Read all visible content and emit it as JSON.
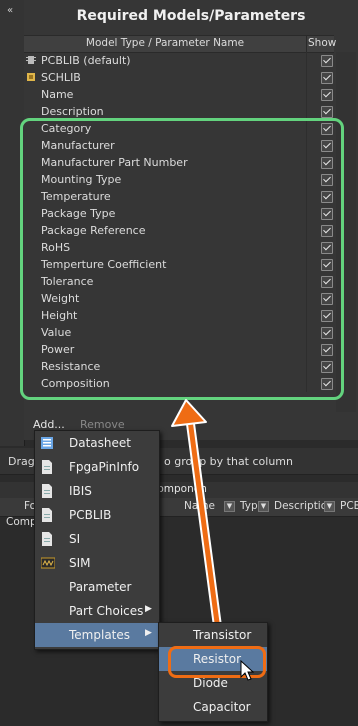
{
  "panel": {
    "collapse_glyph": "«",
    "title": "Required Models/Parameters",
    "col_name": "Model Type / Parameter Name",
    "col_show": "Show",
    "rows": [
      {
        "label": "PCBLIB (default)",
        "icon": "chip-icon"
      },
      {
        "label": "SCHLIB",
        "icon": "schlib-icon"
      },
      {
        "label": "Name"
      },
      {
        "label": "Description"
      },
      {
        "label": "Category"
      },
      {
        "label": "Manufacturer"
      },
      {
        "label": "Manufacturer Part Number"
      },
      {
        "label": "Mounting Type"
      },
      {
        "label": "Temperature"
      },
      {
        "label": "Package Type"
      },
      {
        "label": "Package Reference"
      },
      {
        "label": "RoHS"
      },
      {
        "label": "Temperture Coefficient"
      },
      {
        "label": "Tolerance"
      },
      {
        "label": "Weight"
      },
      {
        "label": "Height"
      },
      {
        "label": "Value"
      },
      {
        "label": "Power"
      },
      {
        "label": "Resistance"
      },
      {
        "label": "Composition"
      }
    ],
    "add_label": "Add...",
    "remove_label": "Remove"
  },
  "lower": {
    "group_hint_left": "Drag",
    "group_hint_right": "o group by that column",
    "component_group": "Componen",
    "columns": [
      "Fo",
      "Name",
      "Typ",
      "Descriptio",
      "PCB"
    ],
    "row_text": "Comp"
  },
  "menu": {
    "items": [
      {
        "label": "Datasheet",
        "icon": "datasheet-icon"
      },
      {
        "label": "FpgaPinInfo",
        "icon": "document-icon"
      },
      {
        "label": "IBIS",
        "icon": "document-icon"
      },
      {
        "label": "PCBLIB",
        "icon": "document-icon"
      },
      {
        "label": "SI",
        "icon": "document-icon"
      },
      {
        "label": "SIM",
        "icon": "sim-icon"
      },
      {
        "label": "Parameter"
      },
      {
        "label": "Part Choices",
        "submenu": true
      },
      {
        "label": "Templates",
        "submenu": true,
        "selected": true
      }
    ],
    "submenu_arrow": "▶"
  },
  "submenu": {
    "items": [
      "Transistor",
      "Resistor",
      "Diode",
      "Capacitor"
    ],
    "selected": "Resistor"
  },
  "colors": {
    "highlight_green": "#63d37e",
    "callout_orange": "#ef6c14",
    "selection_blue": "#5a7aa0"
  }
}
